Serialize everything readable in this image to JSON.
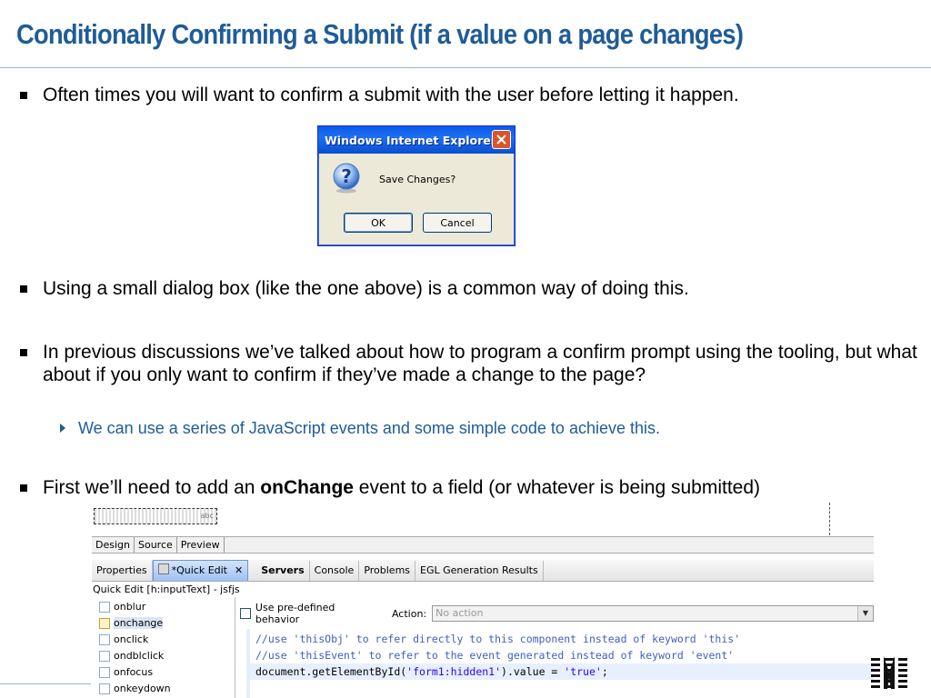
{
  "slide": {
    "title": "Conditionally Confirming a Submit (if a value on a page changes)",
    "bullets": [
      "Often times you will want to confirm a submit with the user before letting it happen.",
      "Using a small dialog box (like the one above) is a common way of doing this.",
      "In previous discussions we’ve talked about how to program a confirm prompt using the tooling, but what about if you only want to confirm if they’ve made a change to the page?",
      {
        "pre": "First we’ll need to add an ",
        "bold": "onChange",
        "post": " event to a field (or whatever is being submitted)"
      }
    ],
    "sub_bullet": "We can use a series of JavaScript events and some simple code to achieve this."
  },
  "dialog": {
    "title": "Windows Internet Explorer",
    "message": "Save Changes?",
    "ok_label": "OK",
    "cancel_label": "Cancel",
    "close_icon": "close-icon",
    "question_icon": "question-icon"
  },
  "ide": {
    "field_hint": "abc",
    "editor_tabs": [
      "Design",
      "Source",
      "Preview"
    ],
    "view_tabs": [
      "Properties",
      "*Quick Edit",
      "Servers",
      "Console",
      "Problems",
      "EGL Generation Results"
    ],
    "quick_edit_header": "Quick Edit [h:inputText] - jsfjs",
    "events": [
      "onblur",
      "onchange",
      "onclick",
      "ondblclick",
      "onfocus",
      "onkeydown"
    ],
    "selected_event": "onchange",
    "predefined_label": "Use pre-defined behavior",
    "action_label": "Action:",
    "action_value": "No action",
    "code": {
      "line1": "//use 'thisObj' to refer directly to this component instead of keyword 'this'",
      "line2": "//use 'thisEvent' to refer to the event generated instead of keyword 'event'",
      "line3_pre": "document.getElementById(",
      "line3_str1": "'form1:hidden1'",
      "line3_mid": ").value = ",
      "line3_str2": "'true'",
      "line3_post": ";"
    }
  },
  "colors": {
    "title": "#1f5c98",
    "sub_bullet": "#1f5c98",
    "comment": "#3f5fbf",
    "string": "#2a00ff"
  }
}
